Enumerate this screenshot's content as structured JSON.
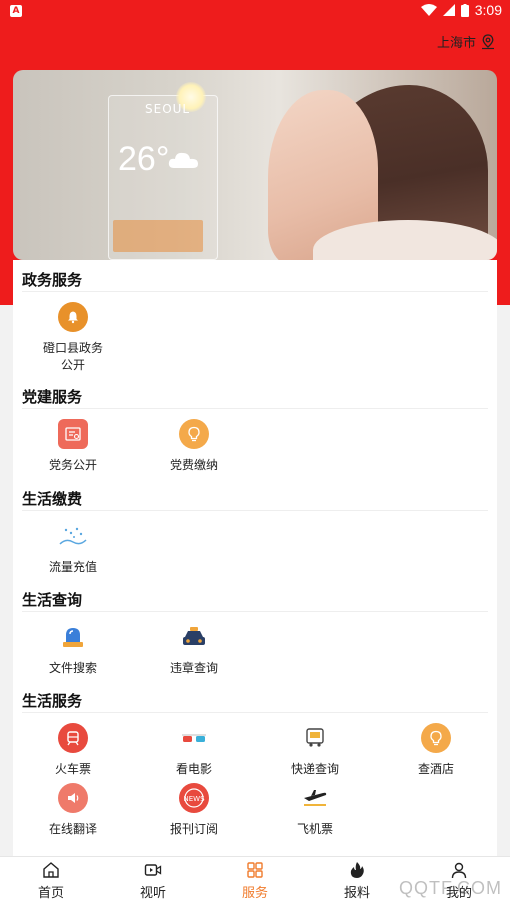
{
  "statusbar": {
    "time": "3:09",
    "notification_badge": "A"
  },
  "header": {
    "city": "上海市"
  },
  "banner": {
    "city_text": "SEOUL",
    "temp": "26°"
  },
  "sections": [
    {
      "title": "政务服务",
      "items": [
        {
          "label": "磴口县政务公开",
          "icon": "bell-icon",
          "color": "#e8912a"
        }
      ]
    },
    {
      "title": "党建服务",
      "items": [
        {
          "label": "党务公开",
          "icon": "document-icon",
          "color": "#ee6a5a"
        },
        {
          "label": "党费缴纳",
          "icon": "lightbulb-icon",
          "color": "#f4a94a"
        }
      ]
    },
    {
      "title": "生活缴费",
      "items": [
        {
          "label": "流量充值",
          "icon": "data-flow-icon",
          "color": "#5aa7e0"
        }
      ]
    },
    {
      "title": "生活查询",
      "items": [
        {
          "label": "文件搜索",
          "icon": "alarm-light-icon",
          "color": "#3a7fd9"
        },
        {
          "label": "违章查询",
          "icon": "car-icon",
          "color": "#f0a53a"
        }
      ]
    },
    {
      "title": "生活服务",
      "items": [
        {
          "label": "火车票",
          "icon": "train-icon",
          "color": "#e84a3e"
        },
        {
          "label": "看电影",
          "icon": "3d-glasses-icon",
          "color": "#e84a3e"
        },
        {
          "label": "快递查询",
          "icon": "delivery-truck-icon",
          "color": "#f0b43a"
        },
        {
          "label": "查酒店",
          "icon": "lightbulb-icon",
          "color": "#f4a94a"
        },
        {
          "label": "在线翻译",
          "icon": "speaker-icon",
          "color": "#ef7a6a"
        },
        {
          "label": "报刊订阅",
          "icon": "news-icon",
          "color": "#e84a3e"
        },
        {
          "label": "飞机票",
          "icon": "airplane-icon",
          "color": "#f0b43a"
        }
      ]
    }
  ],
  "tabs": [
    {
      "label": "首页",
      "icon": "home-icon",
      "active": false
    },
    {
      "label": "视听",
      "icon": "video-icon",
      "active": false
    },
    {
      "label": "服务",
      "icon": "grid-icon",
      "active": true
    },
    {
      "label": "报料",
      "icon": "flame-icon",
      "active": false
    },
    {
      "label": "我的",
      "icon": "user-icon",
      "active": false
    }
  ],
  "watermark": "QQTF.COM",
  "colors": {
    "brand_red": "#ee1c1c",
    "active_tab": "#f07b2c"
  }
}
